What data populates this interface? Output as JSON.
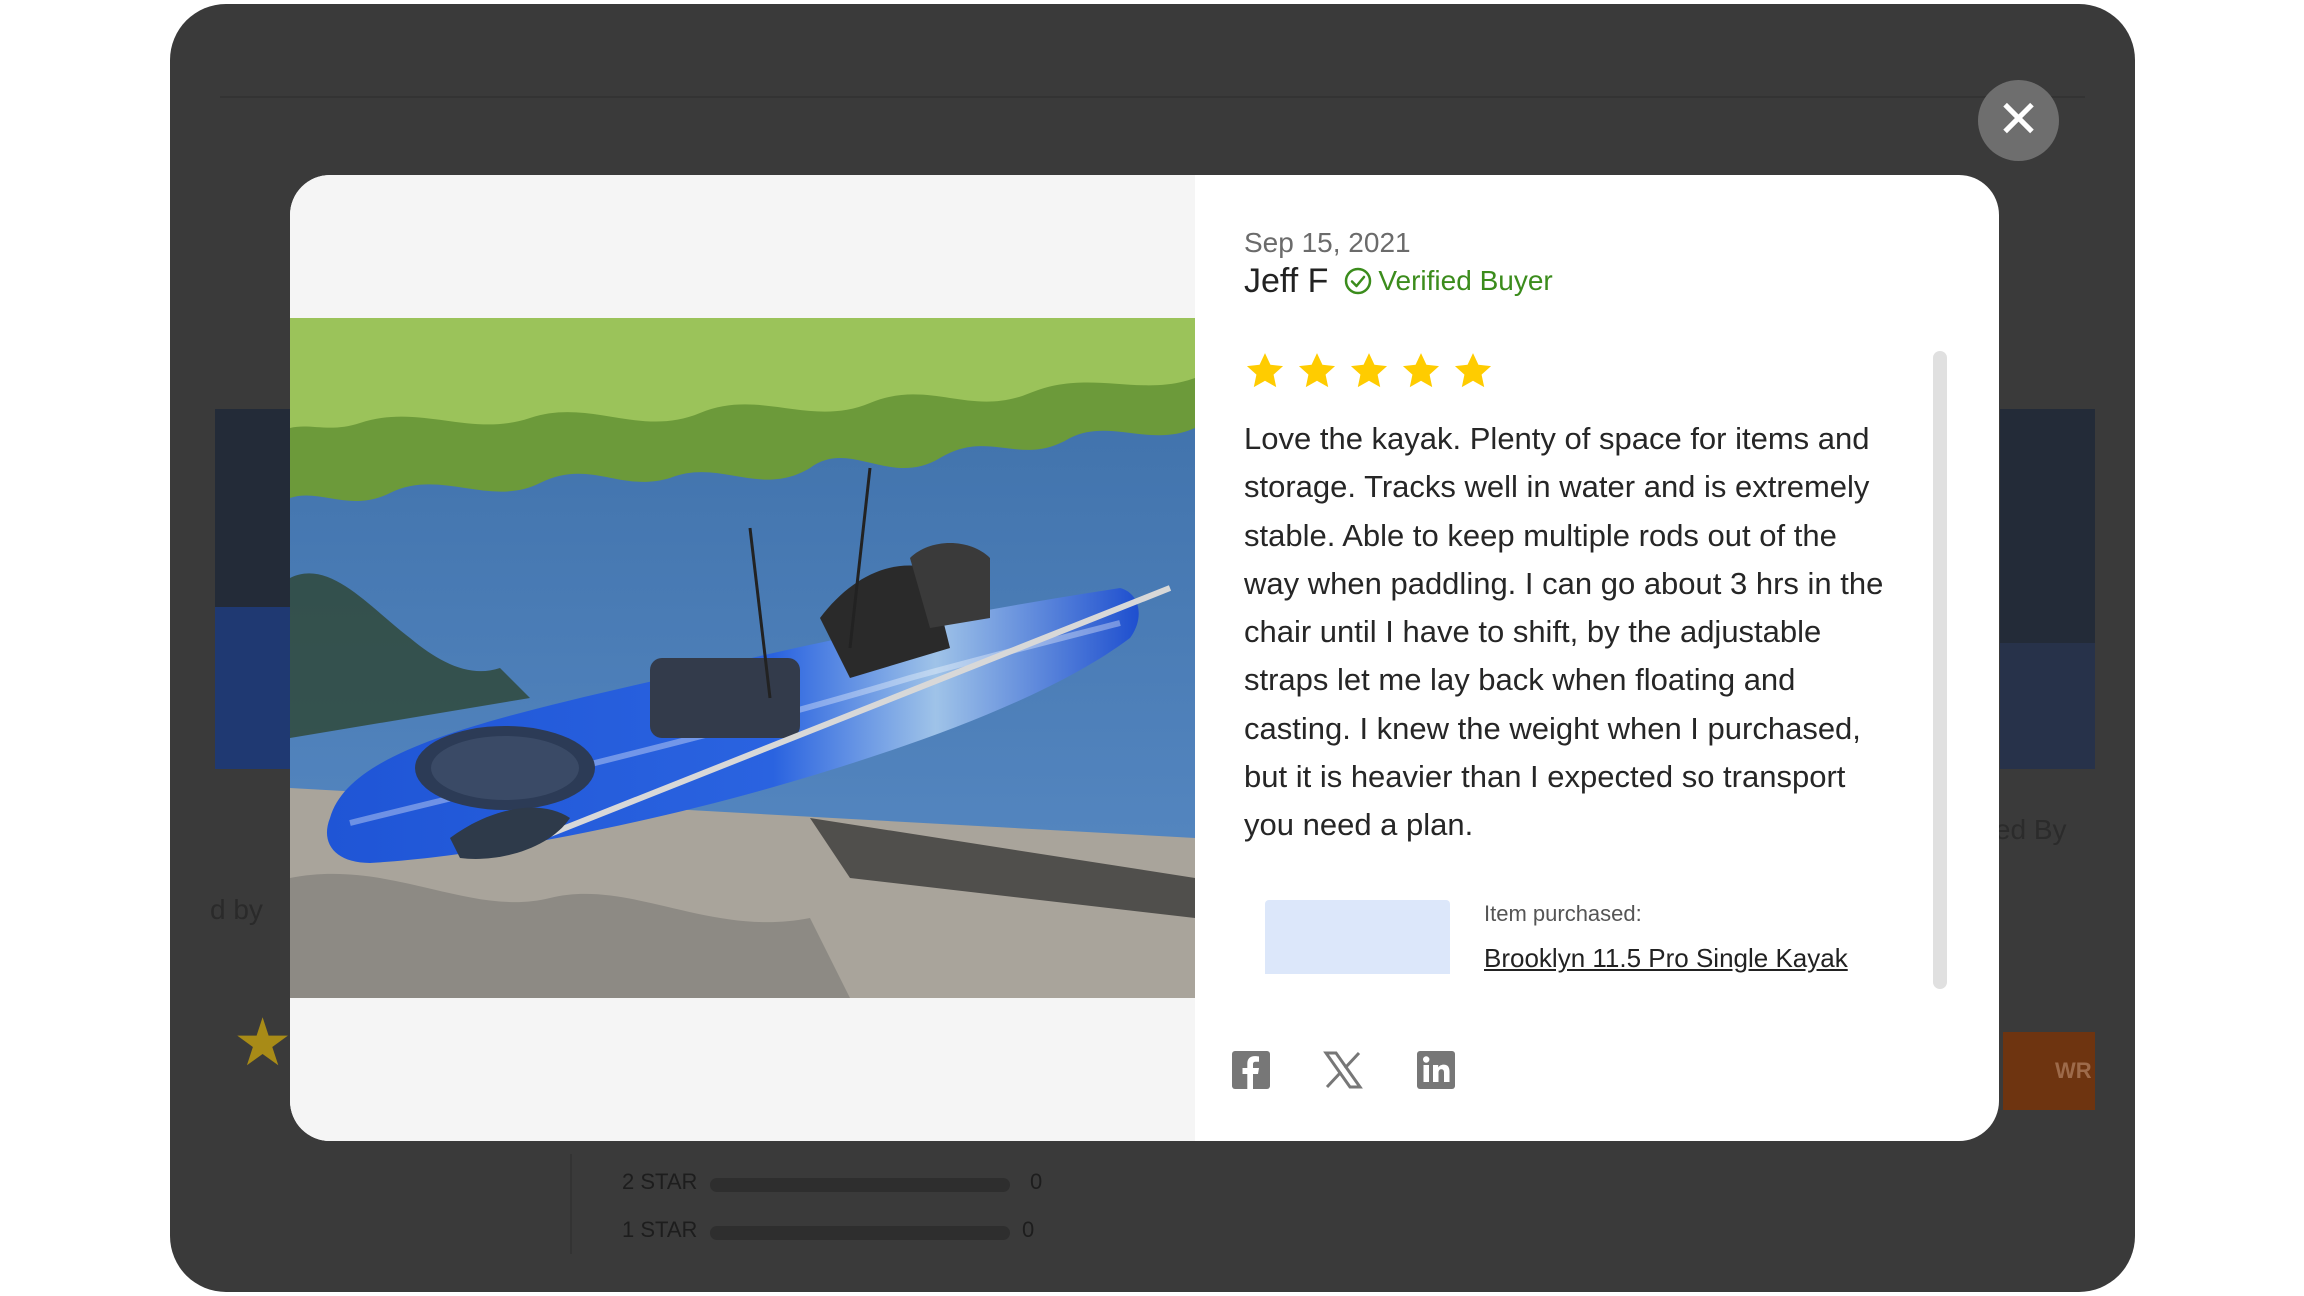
{
  "background": {
    "left_fragment": "d by",
    "right_fragment": "ered By",
    "write_button_fragment": "WR",
    "rating_rows": [
      {
        "label": "2 STAR",
        "count": "0"
      },
      {
        "label": "1 STAR",
        "count": "0"
      }
    ]
  },
  "modal": {
    "close_label": "✕",
    "review": {
      "date": "Sep 15, 2021",
      "reviewer": "Jeff F",
      "verified_label": "Verified Buyer",
      "rating": 5,
      "rating_max": 5,
      "body": "Love the kayak. Plenty of space for items and\nstorage. Tracks well in water and is extremely\nstable. Able to keep multiple rods out of the\nway when paddling. I can go about 3 hrs in the\nchair until I have to shift, by the adjustable\nstraps let me lay back when floating and\ncasting. I knew the weight when I purchased,\nbut it is heavier than I expected so transport\nyou need a plan."
    },
    "item": {
      "label": "Item purchased:",
      "name": "Brooklyn 11.5 Pro Single Kayak"
    },
    "share_icons": [
      "facebook-icon",
      "x-icon",
      "linkedin-icon"
    ]
  },
  "colors": {
    "star": "#FFCC00",
    "verified": "#3B8C1C",
    "overlay": "#3A3A3A"
  }
}
